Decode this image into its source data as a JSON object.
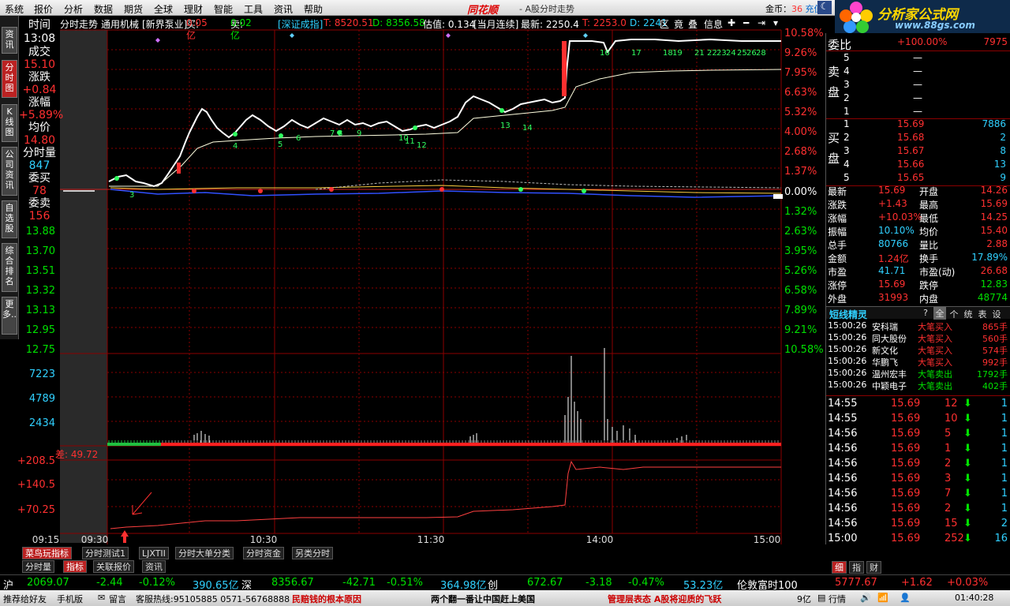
{
  "menu": [
    "系统",
    "报价",
    "分析",
    "数据",
    "期货",
    "全球",
    "理财",
    "智能",
    "工具",
    "资讯",
    "帮助"
  ],
  "app_title": "同花顺",
  "app_subtitle": "- A股分时走势",
  "gold_label": "金币：",
  "gold_value": "36",
  "gold_action": "充值",
  "logo": {
    "text": "分析家公式网",
    "url": "www.88gs.com"
  },
  "side_tabs": [
    "资讯",
    "分时图",
    "K线图",
    "公司资讯",
    "自选股",
    "综合排名",
    "更多.."
  ],
  "info": {
    "time_label": "时间",
    "time": "13:08",
    "vol_label": "成交",
    "price": "15.10",
    "chg_label": "涨跌",
    "chg": "+0.84",
    "pct_label": "涨幅",
    "pct": "+5.89%",
    "avg_label": "均价",
    "avg": "14.80",
    "mvol_label": "分时量",
    "mvol": "847",
    "bid_label": "委买",
    "bid": "78",
    "ask_label": "委卖",
    "ask": "156"
  },
  "toolbar": {
    "tab": "分时走势",
    "name": "通用机械",
    "sector": "[新界泵业]",
    "buy_label": "买:",
    "buy": "0.05亿",
    "sell_label": "卖:",
    "sell": "0.02亿",
    "index": "[深证成指]",
    "t": "T: 8520.51",
    "d": "D: 8356.58",
    "est": "估值: 0.134",
    "monthly": "[当月连续]",
    "latest": "最新: 2250.4",
    "t2": "T: 2253.0",
    "d2": "D: 2241",
    "icons": [
      "区",
      "竟",
      "叠",
      "信息"
    ]
  },
  "price_axis_left": [
    "13.88",
    "13.70",
    "13.51",
    "13.32",
    "13.13",
    "12.95",
    "12.75"
  ],
  "pct_axis_right": [
    "10.58%",
    "9.26%",
    "7.95%",
    "6.63%",
    "5.32%",
    "4.00%",
    "2.68%",
    "1.37%",
    "0.00%",
    "1.32%",
    "2.63%",
    "3.95%",
    "5.26%",
    "6.58%",
    "7.89%",
    "9.21%",
    "10.58%"
  ],
  "vol_axis": [
    "7223",
    "4789",
    "2434"
  ],
  "diff_label": "差: 49.72",
  "ind_axis": [
    "+208.5",
    "+140.5",
    "+70.25"
  ],
  "time_axis": [
    "09:15",
    "09:30",
    "10:30",
    "11:30",
    "14:00",
    "15:00"
  ],
  "chart_labels": [
    "3",
    "4",
    "5",
    "6",
    "7",
    "8",
    "9",
    "10",
    "11",
    "12",
    "13",
    "14",
    "16",
    "17",
    "18",
    "19",
    "20",
    "21",
    "22",
    "23",
    "24",
    "25",
    "26",
    "27",
    "28"
  ],
  "price_path": [
    [
      138,
      230
    ],
    [
      150,
      224
    ],
    [
      160,
      222
    ],
    [
      172,
      230
    ],
    [
      182,
      232
    ],
    [
      195,
      236
    ],
    [
      205,
      232
    ],
    [
      212,
      222
    ],
    [
      220,
      210
    ],
    [
      228,
      198
    ],
    [
      235,
      180
    ],
    [
      240,
      168
    ],
    [
      245,
      158
    ],
    [
      250,
      148
    ],
    [
      256,
      138
    ],
    [
      262,
      142
    ],
    [
      268,
      152
    ],
    [
      275,
      162
    ],
    [
      282,
      168
    ],
    [
      290,
      174
    ],
    [
      298,
      168
    ],
    [
      305,
      160
    ],
    [
      312,
      152
    ],
    [
      320,
      146
    ],
    [
      330,
      152
    ],
    [
      340,
      160
    ],
    [
      350,
      166
    ],
    [
      360,
      160
    ],
    [
      370,
      152
    ],
    [
      380,
      158
    ],
    [
      390,
      162
    ],
    [
      400,
      156
    ],
    [
      410,
      150
    ],
    [
      420,
      154
    ],
    [
      430,
      158
    ],
    [
      440,
      152
    ],
    [
      450,
      158
    ],
    [
      460,
      156
    ],
    [
      470,
      160
    ],
    [
      480,
      156
    ],
    [
      490,
      154
    ],
    [
      500,
      160
    ],
    [
      510,
      166
    ],
    [
      520,
      164
    ],
    [
      530,
      160
    ],
    [
      540,
      158
    ],
    [
      550,
      162
    ],
    [
      560,
      158
    ],
    [
      570,
      154
    ],
    [
      580,
      148
    ],
    [
      590,
      130
    ],
    [
      600,
      122
    ],
    [
      610,
      126
    ],
    [
      620,
      130
    ],
    [
      630,
      136
    ],
    [
      640,
      142
    ],
    [
      650,
      138
    ],
    [
      660,
      132
    ],
    [
      670,
      130
    ],
    [
      680,
      128
    ],
    [
      690,
      126
    ],
    [
      700,
      130
    ],
    [
      710,
      128
    ],
    [
      716,
      124
    ],
    [
      718,
      90
    ],
    [
      722,
      52
    ],
    [
      730,
      52
    ],
    [
      750,
      52
    ],
    [
      765,
      54
    ],
    [
      770,
      66
    ],
    [
      780,
      52
    ],
    [
      800,
      50
    ],
    [
      830,
      50
    ],
    [
      860,
      52
    ],
    [
      900,
      50
    ],
    [
      940,
      52
    ],
    [
      990,
      52
    ]
  ],
  "avg_path": [
    [
      138,
      236
    ],
    [
      200,
      236
    ],
    [
      230,
      210
    ],
    [
      250,
      188
    ],
    [
      270,
      180
    ],
    [
      300,
      178
    ],
    [
      350,
      175
    ],
    [
      400,
      173
    ],
    [
      450,
      172
    ],
    [
      500,
      171
    ],
    [
      540,
      170
    ],
    [
      580,
      168
    ],
    [
      600,
      150
    ],
    [
      650,
      145
    ],
    [
      700,
      140
    ],
    [
      716,
      136
    ],
    [
      730,
      110
    ],
    [
      760,
      100
    ],
    [
      800,
      92
    ],
    [
      850,
      90
    ],
    [
      900,
      89
    ],
    [
      990,
      88
    ]
  ],
  "vol_bars": [
    [
      246,
      10
    ],
    [
      250,
      12
    ],
    [
      255,
      15
    ],
    [
      260,
      11
    ],
    [
      265,
      9
    ],
    [
      596,
      8
    ],
    [
      600,
      10
    ],
    [
      604,
      12
    ],
    [
      716,
      35
    ],
    [
      720,
      58
    ],
    [
      724,
      110
    ],
    [
      728,
      52
    ],
    [
      732,
      40
    ],
    [
      736,
      30
    ],
    [
      766,
      120
    ],
    [
      770,
      30
    ],
    [
      776,
      20
    ],
    [
      782,
      15
    ],
    [
      790,
      22
    ],
    [
      798,
      18
    ],
    [
      805,
      10
    ],
    [
      858,
      6
    ],
    [
      864,
      8
    ],
    [
      870,
      10
    ]
  ],
  "ind_path": [
    [
      140,
      670
    ],
    [
      160,
      668
    ],
    [
      200,
      666
    ],
    [
      240,
      662
    ],
    [
      260,
      660
    ],
    [
      300,
      660
    ],
    [
      340,
      658
    ],
    [
      380,
      656
    ],
    [
      420,
      656
    ],
    [
      460,
      656
    ],
    [
      500,
      656
    ],
    [
      540,
      656
    ],
    [
      580,
      655
    ],
    [
      600,
      648
    ],
    [
      650,
      646
    ],
    [
      700,
      642
    ],
    [
      716,
      640
    ],
    [
      720,
      600
    ],
    [
      724,
      585
    ],
    [
      730,
      595
    ],
    [
      760,
      592
    ],
    [
      790,
      595
    ],
    [
      815,
      592
    ],
    [
      850,
      592
    ],
    [
      900,
      592
    ],
    [
      990,
      592
    ]
  ],
  "order_book": {
    "ratio_label": "委比",
    "ratio": "+100.00%",
    "diff": "7975",
    "sell_label": "卖盘",
    "buy_label": "买盘",
    "asks": [
      [
        "5",
        "—",
        ""
      ],
      [
        "4",
        "—",
        ""
      ],
      [
        "3",
        "—",
        ""
      ],
      [
        "2",
        "—",
        ""
      ],
      [
        "1",
        "—",
        ""
      ]
    ],
    "bids": [
      [
        "1",
        "15.69",
        "7886"
      ],
      [
        "2",
        "15.68",
        "2"
      ],
      [
        "3",
        "15.67",
        "8"
      ],
      [
        "4",
        "15.66",
        "13"
      ],
      [
        "5",
        "15.65",
        "9"
      ]
    ]
  },
  "quote": [
    [
      "最新",
      "15.69",
      "开盘",
      "14.26"
    ],
    [
      "涨跌",
      "+1.43",
      "最高",
      "15.69"
    ],
    [
      "涨幅",
      "+10.03%",
      "最低",
      "14.25"
    ],
    [
      "振幅",
      "10.10%",
      "均价",
      "15.40"
    ],
    [
      "总手",
      "80766",
      "量比",
      "2.88"
    ],
    [
      "金额",
      "1.24亿",
      "换手",
      "17.89%"
    ],
    [
      "市盈",
      "41.71",
      "市盈(动)",
      "26.68"
    ],
    [
      "涨停",
      "15.69",
      "跌停",
      "12.83"
    ],
    [
      "外盘",
      "31993",
      "内盘",
      "48774"
    ]
  ],
  "elf": {
    "title": "短线精灵",
    "tabs": [
      "?",
      "全",
      "个",
      "统",
      "表",
      "设"
    ],
    "rows": [
      [
        "15:00:26",
        "安科瑞",
        "大笔买入",
        "865手"
      ],
      [
        "15:00:26",
        "同大股份",
        "大笔买入",
        "560手"
      ],
      [
        "15:00:26",
        "新文化",
        "大笔买入",
        "574手"
      ],
      [
        "15:00:26",
        "华鹏飞",
        "大笔买入",
        "992手"
      ],
      [
        "15:00:26",
        "温州宏丰",
        "大笔卖出",
        "1792手"
      ],
      [
        "15:00:26",
        "中颖电子",
        "大笔卖出",
        "402手"
      ]
    ]
  },
  "ticks": [
    [
      "14:55",
      "15.69",
      "12",
      "1"
    ],
    [
      "14:55",
      "15.69",
      "10",
      "1"
    ],
    [
      "14:56",
      "15.69",
      "5",
      "1"
    ],
    [
      "14:56",
      "15.69",
      "1",
      "1"
    ],
    [
      "14:56",
      "15.69",
      "2",
      "1"
    ],
    [
      "14:56",
      "15.69",
      "3",
      "1"
    ],
    [
      "14:56",
      "15.69",
      "7",
      "1"
    ],
    [
      "14:56",
      "15.69",
      "2",
      "1"
    ],
    [
      "14:56",
      "15.69",
      "15",
      "2"
    ],
    [
      "15:00",
      "15.69",
      "252",
      "16"
    ]
  ],
  "right_tabs": [
    "细",
    "指",
    "财"
  ],
  "bottom_tabs1": [
    "菜鸟玩指标",
    "分时测试1",
    "LJXTII",
    "分时大单分类",
    "分时资金",
    "另类分时"
  ],
  "bottom_tabs2": [
    "分时量",
    "指标",
    "关联报价",
    "资讯"
  ],
  "index_bar": {
    "sh_label": "沪",
    "sh": "2069.07",
    "sh_chg": "-2.44",
    "sh_pct": "-0.12%",
    "sh_amt": "390.65亿",
    "sz_label": "深",
    "sz": "8356.67",
    "sz_chg": "-42.71",
    "sz_pct": "-0.51%",
    "sz_amt": "364.98亿",
    "cy_label": "创",
    "cy": "672.67",
    "cy_chg": "-3.18",
    "cy_pct": "-0.47%",
    "cy_amt": "53.23亿",
    "ft_label": "伦敦富时100",
    "ft": "5777.67",
    "ft_chg": "+1.62",
    "ft_pct": "+0.03%"
  },
  "status_bar": {
    "recommend": "推荐给好友",
    "mobile": "手机版",
    "message": "留言",
    "hotline": "客服热线:95105885 0571-56768888",
    "news1": "民赔钱的根本原因",
    "news2": "两个翻一番让中国赶上美国",
    "news3": "管理层表态 A股将迎质的飞跃",
    "amount": "9亿",
    "market": "行情",
    "time": "01:40:28"
  }
}
